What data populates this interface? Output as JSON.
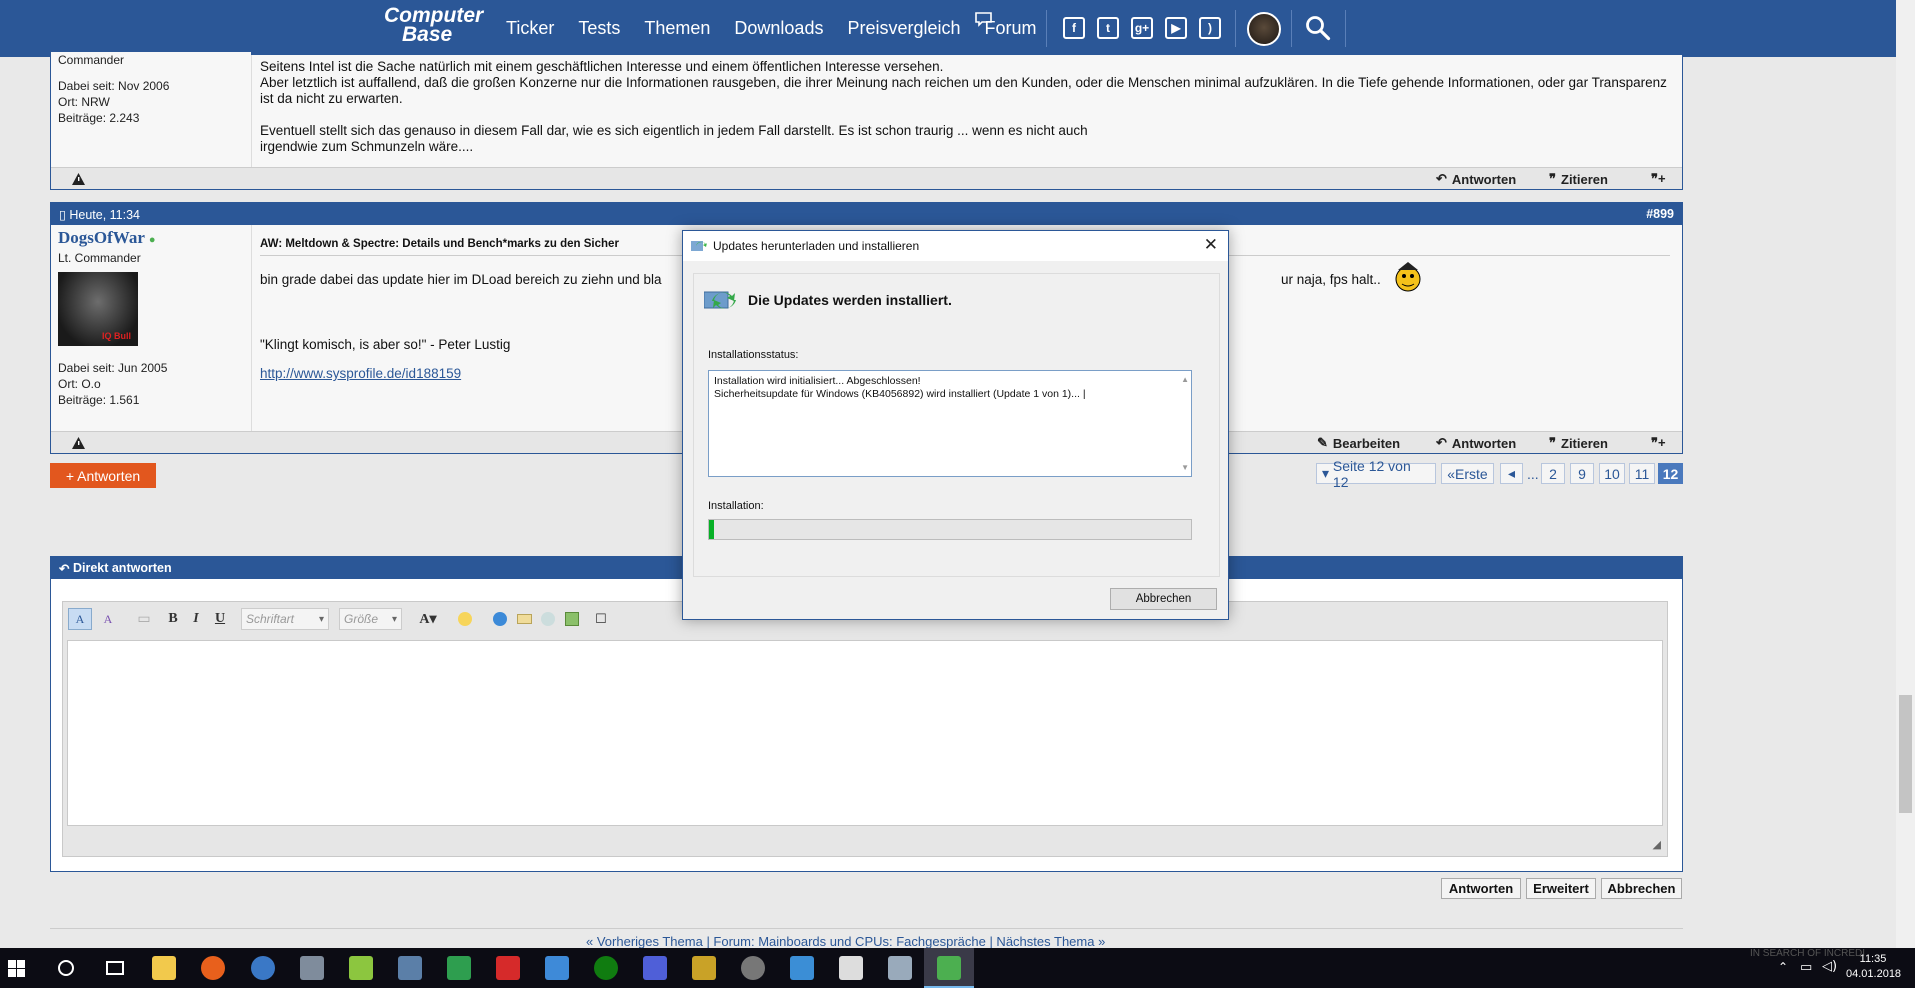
{
  "nav": {
    "logo_line1": "Computer",
    "logo_line2": "Base",
    "links": [
      "Ticker",
      "Tests",
      "Themen",
      "Downloads",
      "Preisvergleich",
      "Forum"
    ],
    "social": [
      "facebook-icon",
      "twitter-icon",
      "google-plus-icon",
      "youtube-icon",
      "rss-icon"
    ],
    "colors": {
      "brand": "#2b5797",
      "accent_orange": "#e2571e"
    }
  },
  "post1": {
    "rank": "Commander",
    "joined": "Dabei seit: Nov 2006",
    "location": "Ort: NRW",
    "posts": "Beiträge: 2.243",
    "text1": "Seitens Intel ist die Sache natürlich mit einem geschäftlichen Interesse und einem öffentlichen Interesse versehen.",
    "text2": "Aber letztlich ist auffallend, daß die großen Konzerne nur die Informationen rausgeben, die ihrer Meinung nach reichen um den Kunden, oder die Menschen minimal aufzuklären. In die Tiefe gehende Informationen, oder gar Transparenz ist da nicht zu erwarten.",
    "text3": "Eventuell stellt sich das genauso in diesem Fall dar, wie es sich eigentlich in jedem Fall darstellt. Es ist schon traurig ... wenn es nicht auch irgendwie zum Schmunzeln wäre....",
    "reply": "Antworten",
    "quote": "Zitieren"
  },
  "post2": {
    "date": "Heute, 11:34",
    "number": "#899",
    "user": "DogsOfWar",
    "rank": "Lt. Commander",
    "avatar_text": "IQ Bull",
    "joined": "Dabei seit: Jun 2005",
    "location": "Ort: O.o",
    "posts": "Beiträge: 1.561",
    "title": "AW: Meltdown & Spectre: Details und Bench*marks zu den Sicher",
    "text_start": "bin grade dabei das update hier im DLoad bereich zu ziehn und bla",
    "text_end": "ur naja, fps halt..",
    "signature_quote": "\"Klingt komisch, is aber so!\" - Peter Lustig",
    "signature_link": "http://www.sysprofile.de/id188159",
    "edit": "Bearbeiten",
    "reply": "Antworten",
    "quote": "Zitieren"
  },
  "reply_button": "+ Antworten",
  "pagination": {
    "page_label": "Seite 12 von 12",
    "first": "Erste",
    "ellipsis": "...",
    "pages": [
      "2",
      "9",
      "10",
      "11",
      "12"
    ],
    "current": "12"
  },
  "quick_reply": {
    "title": "Direkt antworten",
    "font_select": "Schriftart",
    "size_select": "Größe",
    "bold": "B",
    "italic": "I",
    "underline": "U",
    "buttons": [
      "Antworten",
      "Erweitert",
      "Abbrechen"
    ]
  },
  "footer": {
    "text": "« Vorheriges Thema | Forum: Mainboards und CPUs: Fachgespräche | Nächstes Thema »"
  },
  "dialog": {
    "title": "Updates herunterladen und installieren",
    "heading": "Die Updates werden installiert.",
    "status_label": "Installationsstatus:",
    "status_line1": "Installation wird initialisiert... Abgeschlossen!",
    "status_line2": "Sicherheitsupdate für Windows (KB4056892) wird installiert (Update 1 von 1)...",
    "progress_label": "Installation:",
    "progress_fraction": 0.01,
    "cancel": "Abbrechen"
  },
  "taskbar": {
    "time": "11:35",
    "date": "04.01.2018",
    "watermark": "IN SEARCH OF INCREDI"
  }
}
